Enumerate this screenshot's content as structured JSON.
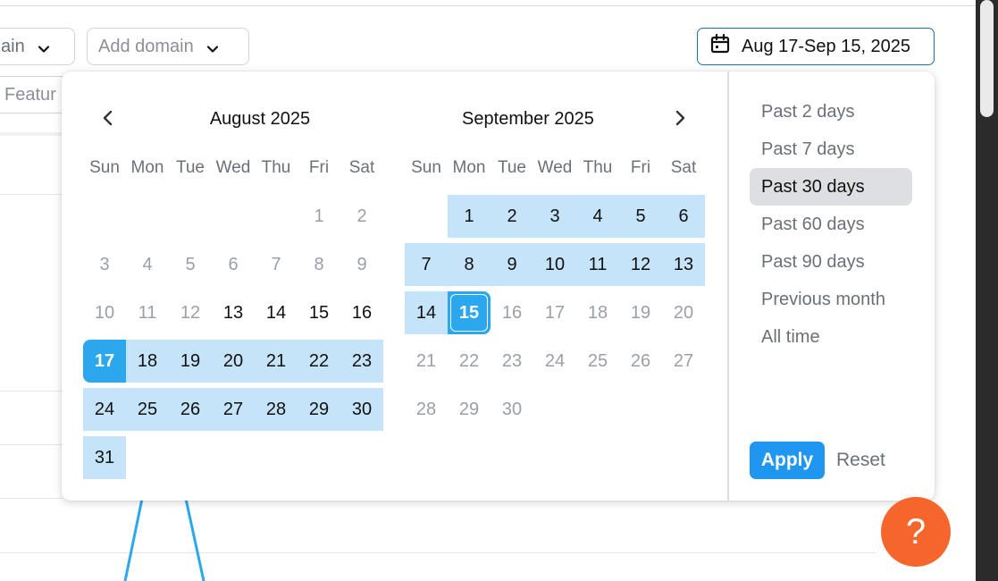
{
  "filters": {
    "domain_partial": "ain",
    "add_domain": "Add domain",
    "feature_partial": "Featur"
  },
  "date_button": {
    "label": "Aug 17-Sep 15, 2025",
    "icon": "calendar-icon"
  },
  "calendar": {
    "weekdays": [
      "Sun",
      "Mon",
      "Tue",
      "Wed",
      "Thu",
      "Fri",
      "Sat"
    ],
    "left_month": {
      "title": "August 2025",
      "days": [
        {
          "d": "",
          "s": "empty"
        },
        {
          "d": "",
          "s": "empty"
        },
        {
          "d": "",
          "s": "empty"
        },
        {
          "d": "",
          "s": "empty"
        },
        {
          "d": "",
          "s": "empty"
        },
        {
          "d": "1",
          "s": "muted"
        },
        {
          "d": "2",
          "s": "muted"
        },
        {
          "d": "3",
          "s": "muted"
        },
        {
          "d": "4",
          "s": "muted"
        },
        {
          "d": "5",
          "s": "muted"
        },
        {
          "d": "6",
          "s": "muted"
        },
        {
          "d": "7",
          "s": "muted"
        },
        {
          "d": "8",
          "s": "muted"
        },
        {
          "d": "9",
          "s": "muted"
        },
        {
          "d": "10",
          "s": "muted"
        },
        {
          "d": "11",
          "s": "muted"
        },
        {
          "d": "12",
          "s": "muted"
        },
        {
          "d": "13",
          "s": "normal"
        },
        {
          "d": "14",
          "s": "normal"
        },
        {
          "d": "15",
          "s": "normal"
        },
        {
          "d": "16",
          "s": "normal"
        },
        {
          "d": "17",
          "s": "start"
        },
        {
          "d": "18",
          "s": "inrange"
        },
        {
          "d": "19",
          "s": "inrange"
        },
        {
          "d": "20",
          "s": "inrange"
        },
        {
          "d": "21",
          "s": "inrange"
        },
        {
          "d": "22",
          "s": "inrange"
        },
        {
          "d": "23",
          "s": "inrange"
        },
        {
          "d": "24",
          "s": "inrange"
        },
        {
          "d": "25",
          "s": "inrange"
        },
        {
          "d": "26",
          "s": "inrange"
        },
        {
          "d": "27",
          "s": "inrange"
        },
        {
          "d": "28",
          "s": "inrange"
        },
        {
          "d": "29",
          "s": "inrange"
        },
        {
          "d": "30",
          "s": "inrange"
        },
        {
          "d": "31",
          "s": "inrange"
        }
      ]
    },
    "right_month": {
      "title": "September 2025",
      "days": [
        {
          "d": "",
          "s": "empty"
        },
        {
          "d": "1",
          "s": "inrange"
        },
        {
          "d": "2",
          "s": "inrange"
        },
        {
          "d": "3",
          "s": "inrange"
        },
        {
          "d": "4",
          "s": "inrange"
        },
        {
          "d": "5",
          "s": "inrange"
        },
        {
          "d": "6",
          "s": "inrange"
        },
        {
          "d": "7",
          "s": "inrange"
        },
        {
          "d": "8",
          "s": "inrange"
        },
        {
          "d": "9",
          "s": "inrange"
        },
        {
          "d": "10",
          "s": "inrange"
        },
        {
          "d": "11",
          "s": "inrange"
        },
        {
          "d": "12",
          "s": "inrange"
        },
        {
          "d": "13",
          "s": "inrange"
        },
        {
          "d": "14",
          "s": "inrange"
        },
        {
          "d": "15",
          "s": "end"
        },
        {
          "d": "16",
          "s": "muted"
        },
        {
          "d": "17",
          "s": "muted"
        },
        {
          "d": "18",
          "s": "muted"
        },
        {
          "d": "19",
          "s": "muted"
        },
        {
          "d": "20",
          "s": "muted"
        },
        {
          "d": "21",
          "s": "muted"
        },
        {
          "d": "22",
          "s": "muted"
        },
        {
          "d": "23",
          "s": "muted"
        },
        {
          "d": "24",
          "s": "muted"
        },
        {
          "d": "25",
          "s": "muted"
        },
        {
          "d": "26",
          "s": "muted"
        },
        {
          "d": "27",
          "s": "muted"
        },
        {
          "d": "28",
          "s": "muted"
        },
        {
          "d": "29",
          "s": "muted"
        },
        {
          "d": "30",
          "s": "muted"
        }
      ]
    }
  },
  "presets": [
    {
      "label": "Past 2 days",
      "active": false
    },
    {
      "label": "Past 7 days",
      "active": false
    },
    {
      "label": "Past 30 days",
      "active": true
    },
    {
      "label": "Past 60 days",
      "active": false
    },
    {
      "label": "Past 90 days",
      "active": false
    },
    {
      "label": "Previous month",
      "active": false
    },
    {
      "label": "All time",
      "active": false
    }
  ],
  "actions": {
    "apply": "Apply",
    "reset": "Reset"
  },
  "help": {
    "label": "?"
  },
  "colors": {
    "range_fill": "#c5e4fa",
    "range_endpoint": "#2ba7ee",
    "apply": "#1f97f0",
    "help": "#f6652c",
    "date_border": "#1c6fa8"
  }
}
